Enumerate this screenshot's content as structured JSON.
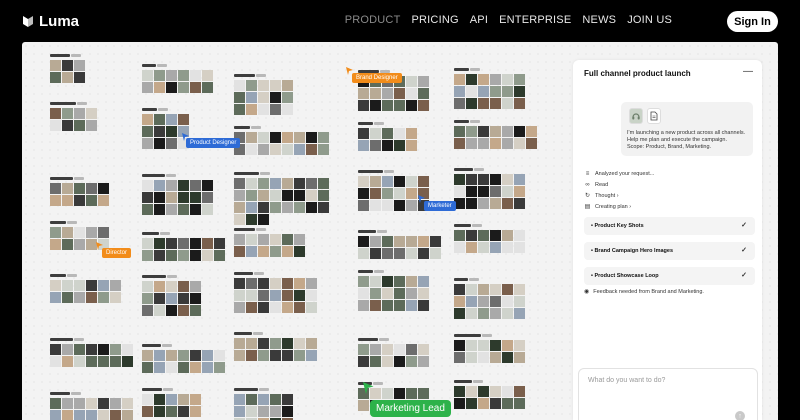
{
  "brand": {
    "name": "Luma"
  },
  "nav": {
    "items": [
      {
        "label": "PRODUCT",
        "active": true
      },
      {
        "label": "PRICING",
        "active": false
      },
      {
        "label": "API",
        "active": false
      },
      {
        "label": "ENTERPRISE",
        "active": false
      },
      {
        "label": "NEWS",
        "active": false
      },
      {
        "label": "JOIN US",
        "active": false
      }
    ],
    "signin_label": "Sign In"
  },
  "canvas": {
    "tags": {
      "product_designer": "Product Designer",
      "brand_designer": "Brand Designer",
      "marketer": "Marketer",
      "director": "Director",
      "marketing_lead": "Marketing Lead"
    }
  },
  "panel": {
    "title": "Full channel product launch",
    "minimize_icon": "minus-icon",
    "message_lines": [
      "I'm launching a new product across all channels.",
      "Help me plan and execute the campaign.",
      "Scope: Product, Brand, Marketing."
    ],
    "steps": [
      {
        "icon": "sliders-icon",
        "label": "Analyzed your request..."
      },
      {
        "icon": "link-icon",
        "label": "Read"
      },
      {
        "icon": "loop-icon",
        "label": "Thought ›"
      },
      {
        "icon": "document-icon",
        "label": "Creating plan ›"
      }
    ],
    "tasks": [
      {
        "label": "• Product Key Shots",
        "done": true
      },
      {
        "label": "• Brand Campaign Hero Images",
        "done": true
      },
      {
        "label": "• Product Showcase Loop",
        "done": true
      }
    ],
    "feedback": "Feedback needed from Brand and Marketing.",
    "input_placeholder": "What do you want to do?"
  },
  "colors": {
    "tag_blue": "#2e6bd6",
    "tag_orange": "#f28c1a",
    "tag_green": "#2db24a"
  }
}
